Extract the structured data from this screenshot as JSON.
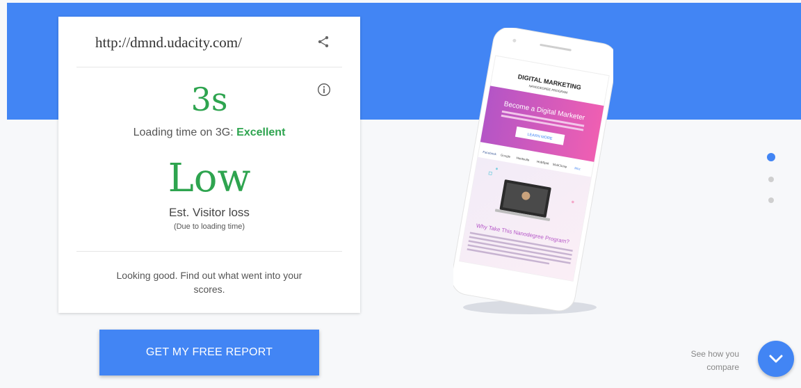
{
  "result_card": {
    "url": "http://dmnd.udacity.com/",
    "loading_time": "3s",
    "loading_desc_prefix": "Loading time on 3G: ",
    "loading_rating": "Excellent",
    "visitor_loss_level": "Low",
    "visitor_loss_label": "Est. Visitor loss",
    "visitor_loss_sub": "(Due to loading time)",
    "footer_message": "Looking good. Find out what went into your scores."
  },
  "cta": {
    "report_button_label": "GET MY FREE REPORT"
  },
  "compare": {
    "line1": "See how you",
    "line2": "compare"
  },
  "carousel": {
    "count": 3,
    "active_index": 0
  },
  "phone_screen": {
    "brand_title": "DIGITAL MARKETING",
    "brand_subtitle": "NANODEGREE PROGRAM",
    "hero_heading": "Become a Digital Marketer",
    "hero_button": "LEARN MORE",
    "partners": [
      "Facebook",
      "Google",
      "Hootsuite",
      "HubSpot",
      "MailChimp",
      "Moz"
    ],
    "section_heading": "Why Take This Nanodegree Program?"
  },
  "colors": {
    "brand_blue": "#4285f4",
    "good_green": "#2ea44f",
    "hero_gradient_start": "#b455c6",
    "hero_gradient_end": "#ef5fb2"
  },
  "icons": [
    "share-icon",
    "info-icon",
    "chevron-down-icon"
  ]
}
